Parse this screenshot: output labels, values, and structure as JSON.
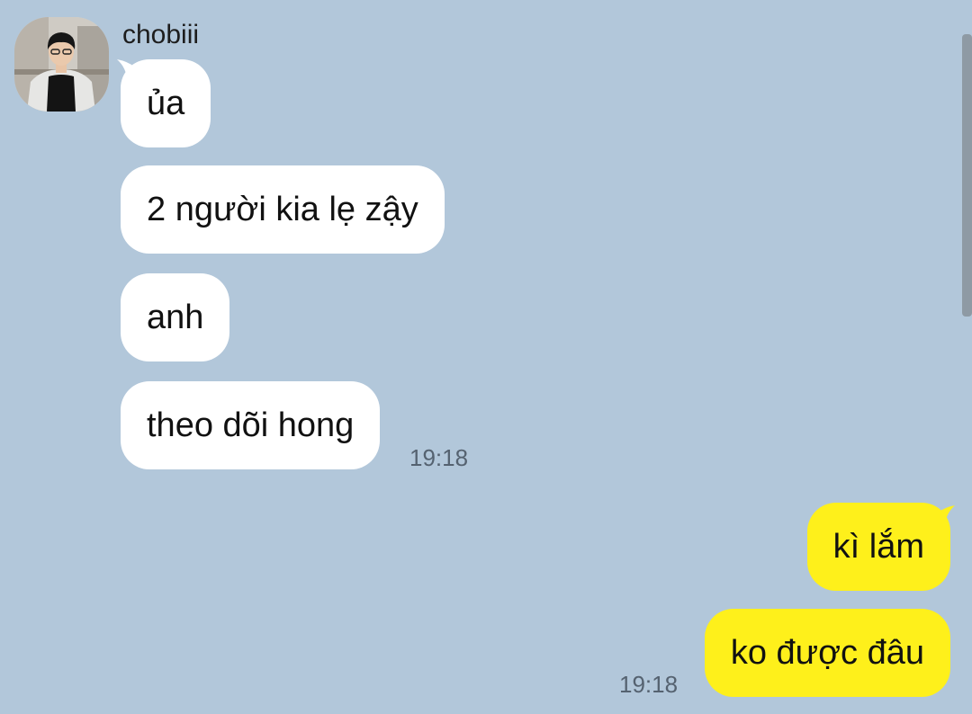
{
  "chat": {
    "sender_name": "chobiii",
    "incoming": [
      {
        "text": "ủa"
      },
      {
        "text": "2 người kia lẹ zậy"
      },
      {
        "text": "anh"
      },
      {
        "text": "theo dõi hong"
      }
    ],
    "incoming_time": "19:18",
    "outgoing": [
      {
        "text": "kì lắm"
      },
      {
        "text": "ko được đâu"
      }
    ],
    "outgoing_time": "19:18"
  },
  "colors": {
    "background": "#b2c7da",
    "incoming_bubble": "#ffffff",
    "outgoing_bubble": "#fef01b"
  }
}
